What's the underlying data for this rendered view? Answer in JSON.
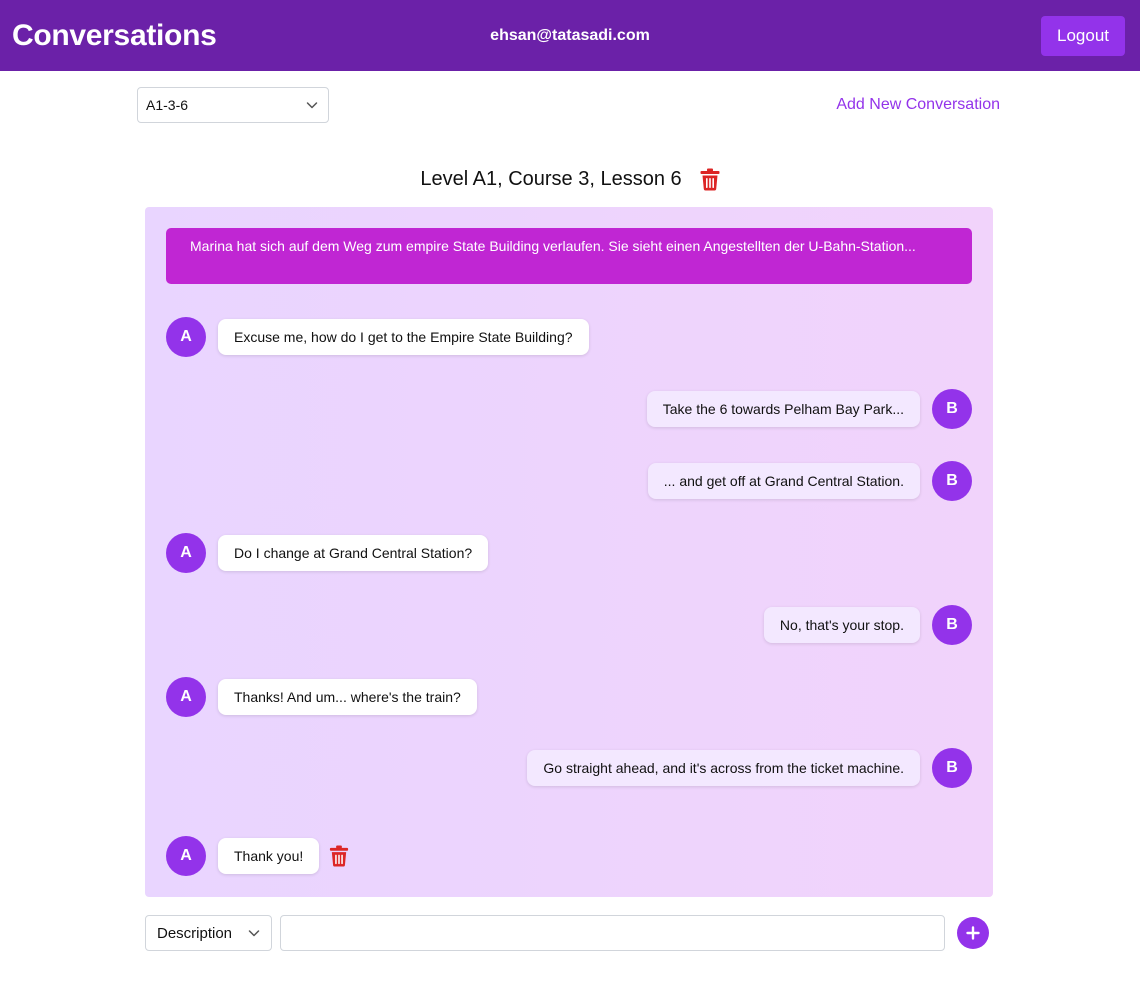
{
  "header": {
    "title": "Conversations",
    "user_email": "ehsan@tatasadi.com",
    "logout_label": "Logout"
  },
  "toolbar": {
    "conversation_select_value": "A1-3-6",
    "add_conversation_label": "Add New Conversation"
  },
  "lesson": {
    "title": "Level A1, Course 3, Lesson 6"
  },
  "chat": {
    "description": "Marina hat sich auf dem Weg zum empire State Building verlaufen. Sie sieht einen Angestellten der U-Bahn-Station...",
    "messages": [
      {
        "speaker": "A",
        "side": "left",
        "text": "Excuse me, how do I get to the Empire State Building?"
      },
      {
        "speaker": "B",
        "side": "right",
        "text": "Take the 6 towards Pelham Bay Park..."
      },
      {
        "speaker": "B",
        "side": "right",
        "text": "... and get off at Grand Central Station."
      },
      {
        "speaker": "A",
        "side": "left",
        "text": "Do I change at Grand Central Station?"
      },
      {
        "speaker": "B",
        "side": "right",
        "text": "No, that's your stop."
      },
      {
        "speaker": "A",
        "side": "left",
        "text": "Thanks! And um... where's the train?"
      },
      {
        "speaker": "B",
        "side": "right",
        "text": "Go straight ahead, and it's across from the ticket machine."
      },
      {
        "speaker": "A",
        "side": "left",
        "text": "Thank you!"
      }
    ]
  },
  "composer": {
    "type_select_value": "Description",
    "input_value": "",
    "input_placeholder": ""
  },
  "colors": {
    "header_bg": "#6b21a8",
    "accent": "#9333ea",
    "description_bg": "#c026d3",
    "delete_red": "#dc2626"
  },
  "icons": {
    "select_chevron": "chevron-down-icon",
    "delete": "trash-icon",
    "add": "plus-icon"
  }
}
